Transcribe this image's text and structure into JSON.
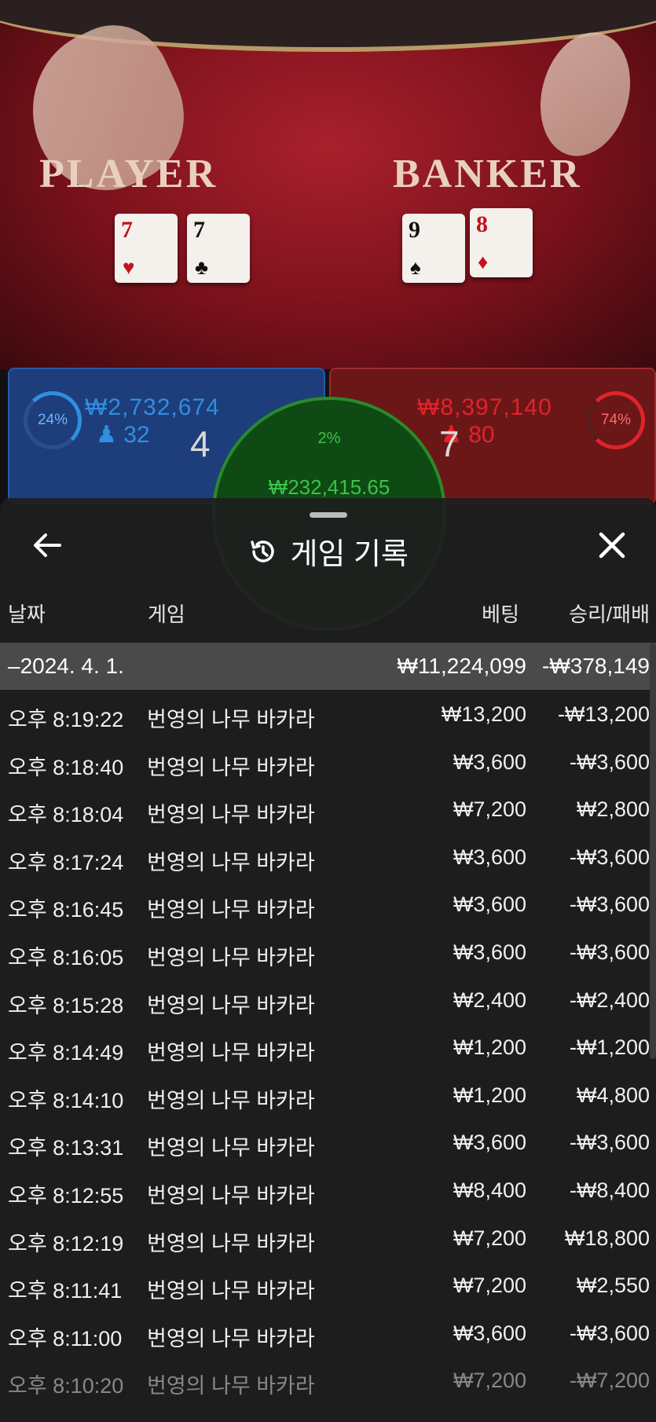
{
  "scene": {
    "player_label": "PLAYER",
    "banker_label": "BANKER",
    "player_cards": [
      {
        "rank": "7",
        "suit": "♥",
        "color": "red"
      },
      {
        "rank": "7",
        "suit": "♣",
        "color": "black"
      }
    ],
    "banker_cards": [
      {
        "rank": "9",
        "suit": "♠",
        "color": "black"
      },
      {
        "rank": "8",
        "suit": "♦",
        "color": "red"
      }
    ],
    "player_stats": {
      "percent": "24%",
      "amount": "₩2,732,674",
      "players": "32",
      "score": "4"
    },
    "banker_stats": {
      "percent": "74%",
      "amount": "₩8,397,140",
      "players": "80",
      "score": "7"
    },
    "tie_stats": {
      "percent": "2%",
      "amount": "₩232,415.65"
    },
    "colors": {
      "player": "#2f8fe0",
      "banker": "#e0232b",
      "tie": "#3cc24a"
    }
  },
  "header": {
    "title": "게임 기록",
    "back_icon": "arrow-left-icon",
    "history_icon": "history-icon",
    "close_icon": "close-icon"
  },
  "columns": {
    "date": "날짜",
    "game": "게임",
    "bet": "베팅",
    "result": "승리/패배"
  },
  "summary": {
    "date": "–2024. 4. 1.",
    "bet": "₩11,224,099",
    "result": "-₩378,149"
  },
  "rows": [
    {
      "time": "오후 8:19:22",
      "game": "번영의 나무 바카라",
      "bet": "₩13,200",
      "result": "-₩13,200"
    },
    {
      "time": "오후 8:18:40",
      "game": "번영의 나무 바카라",
      "bet": "₩3,600",
      "result": "-₩3,600"
    },
    {
      "time": "오후 8:18:04",
      "game": "번영의 나무 바카라",
      "bet": "₩7,200",
      "result": "₩2,800"
    },
    {
      "time": "오후 8:17:24",
      "game": "번영의 나무 바카라",
      "bet": "₩3,600",
      "result": "-₩3,600"
    },
    {
      "time": "오후 8:16:45",
      "game": "번영의 나무 바카라",
      "bet": "₩3,600",
      "result": "-₩3,600"
    },
    {
      "time": "오후 8:16:05",
      "game": "번영의 나무 바카라",
      "bet": "₩3,600",
      "result": "-₩3,600"
    },
    {
      "time": "오후 8:15:28",
      "game": "번영의 나무 바카라",
      "bet": "₩2,400",
      "result": "-₩2,400"
    },
    {
      "time": "오후 8:14:49",
      "game": "번영의 나무 바카라",
      "bet": "₩1,200",
      "result": "-₩1,200"
    },
    {
      "time": "오후 8:14:10",
      "game": "번영의 나무 바카라",
      "bet": "₩1,200",
      "result": "₩4,800"
    },
    {
      "time": "오후 8:13:31",
      "game": "번영의 나무 바카라",
      "bet": "₩3,600",
      "result": "-₩3,600"
    },
    {
      "time": "오후 8:12:55",
      "game": "번영의 나무 바카라",
      "bet": "₩8,400",
      "result": "-₩8,400"
    },
    {
      "time": "오후 8:12:19",
      "game": "번영의 나무 바카라",
      "bet": "₩7,200",
      "result": "₩18,800"
    },
    {
      "time": "오후 8:11:41",
      "game": "번영의 나무 바카라",
      "bet": "₩7,200",
      "result": "₩2,550"
    },
    {
      "time": "오후 8:11:00",
      "game": "번영의 나무 바카라",
      "bet": "₩3,600",
      "result": "-₩3,600"
    },
    {
      "time": "오후 8:10:20",
      "game": "번영의 나무 바카라",
      "bet": "₩7,200",
      "result": "-₩7,200"
    }
  ]
}
